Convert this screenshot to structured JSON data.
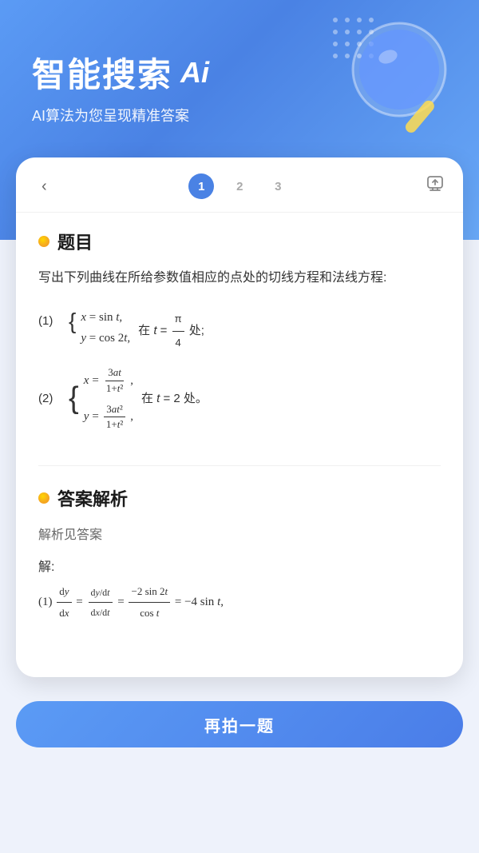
{
  "header": {
    "title": "智能搜索",
    "ai_label": "Ai",
    "subtitle": "AI算法为您呈现精准答案"
  },
  "nav": {
    "back_icon": "‹",
    "pages": [
      "1",
      "2",
      "3"
    ],
    "active_page": 1,
    "share_icon": "⎋"
  },
  "problem_section": {
    "dot_color": "#f5a623",
    "title": "题目",
    "description": "写出下列曲线在所给参数值相应的点处的切线方程和法线方程:",
    "items": [
      {
        "num": "(1)",
        "eq1": "x = sin t,",
        "eq2": "y = cos 2t,",
        "condition": "在 t = π/4 处;"
      },
      {
        "num": "(2)",
        "eq1": "x = 3at / (1+t²),",
        "eq2": "y = 3at² / (1+t²),",
        "condition": "在 t = 2 处。"
      }
    ]
  },
  "answer_section": {
    "dot_color": "#f5a623",
    "title": "答案解析",
    "note": "解析见答案",
    "solve_label": "解:",
    "formula": "(1) dy/dx = (dy/dt)/(dx/dt) = -2sin2t / cost = -4sint,"
  },
  "button": {
    "label": "再拍一题"
  }
}
